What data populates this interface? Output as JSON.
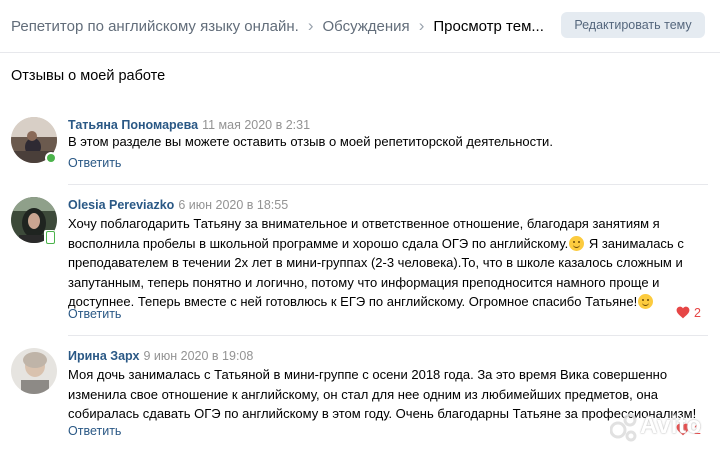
{
  "breadcrumb": {
    "items": [
      {
        "label": "Репетитор по английскому языку онлайн."
      },
      {
        "label": "Обсуждения"
      },
      {
        "label": "Просмотр тем..."
      }
    ]
  },
  "header": {
    "edit_button": "Редактировать тему"
  },
  "topic": {
    "title": "Отзывы о моей работе"
  },
  "posts": [
    {
      "author": "Татьяна Пономарева",
      "date": "11 мая 2020 в 2:31",
      "text": "В этом разделе вы можете оставить отзыв о моей репетиторской деятельности.",
      "reply_label": "Ответить",
      "status": "online"
    },
    {
      "author": "Olesia Pereviazko",
      "date": "6 июн 2020 в 18:55",
      "text_part1": "Хочу поблагодарить Татьяну за внимательное и ответственное отношение, благодаря занятиям я восполнила пробелы в школьной программе и хорошо сдала ОГЭ по английскому.",
      "text_part2": " Я занималась с преподавателем в течении 2х лет в мини-группах (2-3 человека).То, что в школе казалось сложным и запутанным, теперь понятно и логично, потому что информация преподносится намного проще и доступнее. Теперь вместе с ней готовлюсь к ЕГЭ по английскому. Огромное спасибо Татьяне!",
      "reply_label": "Ответить",
      "likes": "2",
      "status": "mobile"
    },
    {
      "author": "Ирина Зарх",
      "date": "9 июн 2020 в 19:08",
      "text": "Моя дочь занималась с Татьяной в мини-группе с осени 2018 года. За это время Вика совершенно изменила свое отношение к английскому, он стал для нее одним из любимейших предметов, она собиралась сдавать ОГЭ по английскому в этом году. Очень благодарны Татьяне за профессионализм!",
      "reply_label": "Ответить",
      "likes": "2"
    }
  ],
  "colors": {
    "link": "#2a5885",
    "muted": "#939393",
    "like": "#e64646",
    "online": "#4bb34b",
    "button_bg": "#e5ebf1"
  },
  "icons": [
    "chevron-right-icon",
    "heart-icon",
    "online-status-icon",
    "mobile-status-icon",
    "smile-emoji-icon"
  ],
  "watermark": "Avito"
}
